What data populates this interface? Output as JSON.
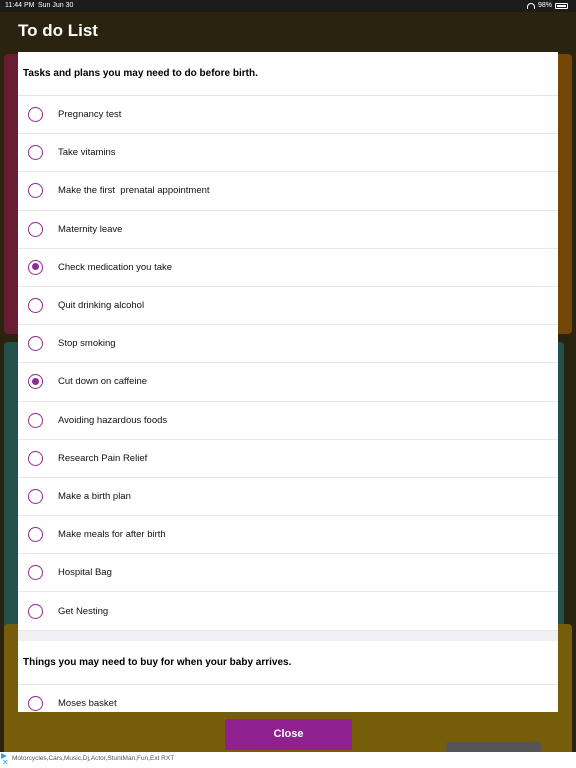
{
  "status_bar": {
    "time": "11:44 PM",
    "date": "Sun Jun 30",
    "battery": "98%"
  },
  "modal": {
    "title": "To do List",
    "sections": [
      {
        "header": "Tasks and plans you may need to do before birth.",
        "items": [
          {
            "label": "Pregnancy test",
            "checked": false
          },
          {
            "label": "Take vitamins",
            "checked": false
          },
          {
            "label": "Make the first  prenatal appointment",
            "checked": false
          },
          {
            "label": "Maternity leave",
            "checked": false
          },
          {
            "label": "Check medication you take",
            "checked": true
          },
          {
            "label": "Quit drinking alcohol",
            "checked": false
          },
          {
            "label": "Stop smoking",
            "checked": false
          },
          {
            "label": "Cut down on caffeine",
            "checked": true
          },
          {
            "label": "Avoiding hazardous foods",
            "checked": false
          },
          {
            "label": "Research Pain Relief",
            "checked": false
          },
          {
            "label": "Make a birth plan",
            "checked": false
          },
          {
            "label": "Make meals for after birth",
            "checked": false
          },
          {
            "label": "Hospital Bag",
            "checked": false
          },
          {
            "label": "Get Nesting",
            "checked": false
          }
        ]
      },
      {
        "header": "Things you may need to buy for when your baby arrives.",
        "items": [
          {
            "label": "Moses basket",
            "checked": false
          }
        ]
      }
    ],
    "close_label": "Close"
  },
  "ad": {
    "text": "Motorcycles,Cars,Music,Dj,Actor,StuntMan,Fun,Ext RXT"
  },
  "colors": {
    "accent": "#8e218f",
    "tile_pink": "#cf1b86",
    "tile_orange": "#f08a12",
    "tile_blue": "#1aa3c9",
    "tile_yellow": "#f4c21a"
  }
}
